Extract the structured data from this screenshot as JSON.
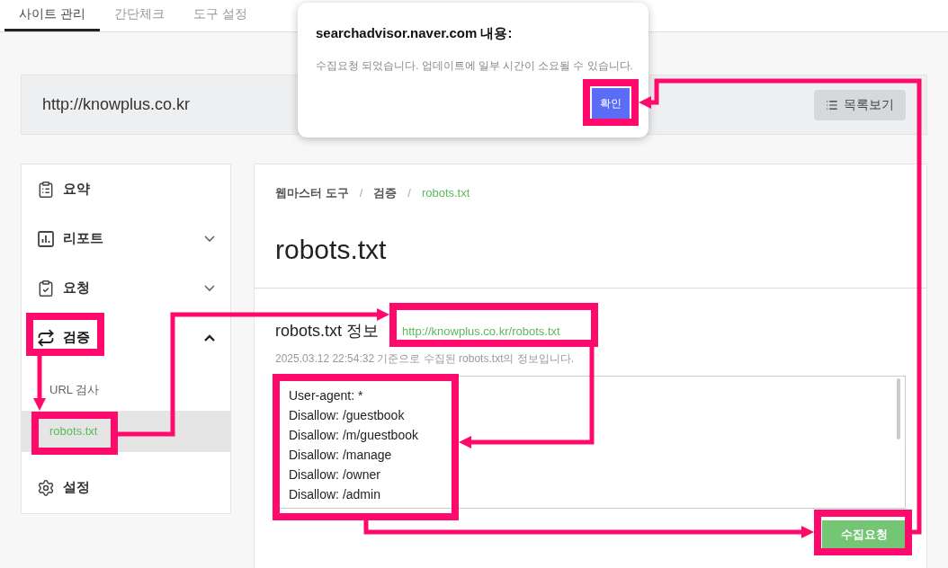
{
  "tabs": [
    {
      "label": "사이트 관리",
      "selected": true
    },
    {
      "label": "간단체크",
      "selected": false
    },
    {
      "label": "도구 설정",
      "selected": false
    }
  ],
  "site": {
    "url": "http://knowplus.co.kr",
    "list_button": "목록보기"
  },
  "sidebar": {
    "items": [
      {
        "label": "요약"
      },
      {
        "label": "리포트",
        "expanded": false
      },
      {
        "label": "요청",
        "expanded": false
      },
      {
        "label": "검증",
        "expanded": true,
        "children": [
          {
            "label": "URL 검사",
            "selected": false
          },
          {
            "label": "robots.txt",
            "selected": true
          }
        ]
      },
      {
        "label": "설정"
      }
    ]
  },
  "main": {
    "breadcrumb": [
      {
        "label": "웹마스터 도구",
        "selected": false
      },
      {
        "label": "검증",
        "selected": false,
        "separator": "/"
      },
      {
        "label": "robots.txt",
        "selected": true,
        "separator": "/"
      }
    ],
    "title": "robots.txt",
    "section": {
      "heading": "robots.txt 정보",
      "url": "http://knowplus.co.kr/robots.txt",
      "note": "2025.03.12 22:54:32 기준으로 수집된 robots.txt의 정보입니다.",
      "content": [
        "User-agent: *",
        "Disallow: /guestbook",
        "Disallow: /m/guestbook",
        "Disallow: /manage",
        "Disallow: /owner",
        "Disallow: /admin"
      ]
    },
    "submit_button": "수집요청"
  },
  "dialog": {
    "title": "searchadvisor.naver.com 내용:",
    "message": "수집요청 되었습니다. 업데이트에 일부 시간이 소요될 수 있습니다.",
    "ok_button": "확인"
  }
}
